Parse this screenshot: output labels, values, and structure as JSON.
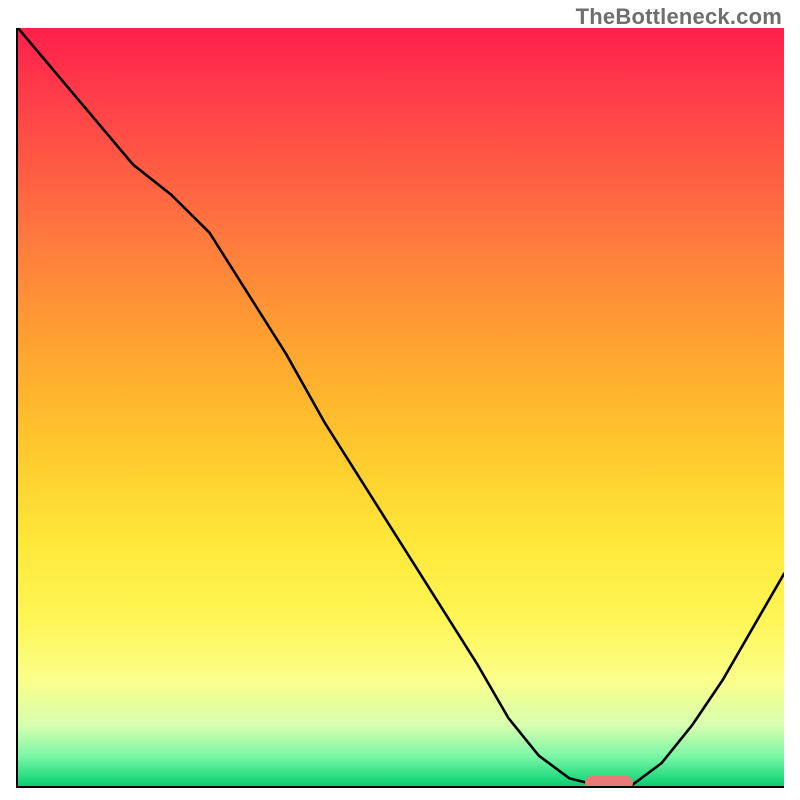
{
  "attribution": "TheBottleneck.com",
  "colors": {
    "axis": "#000000",
    "curve": "#000000",
    "marker": "#e97a78",
    "gradient_top": "#ff1f4b",
    "gradient_bottom": "#0fc96f"
  },
  "chart_data": {
    "type": "line",
    "title": "",
    "xlabel": "",
    "ylabel": "",
    "xlim": [
      0,
      100
    ],
    "ylim": [
      0,
      100
    ],
    "grid": false,
    "legend": false,
    "series": [
      {
        "name": "bottleneck-curve",
        "x": [
          0,
          5,
          10,
          15,
          20,
          25,
          30,
          35,
          40,
          45,
          50,
          55,
          60,
          64,
          68,
          72,
          76,
          80,
          84,
          88,
          92,
          96,
          100
        ],
        "values": [
          100,
          94,
          88,
          82,
          78,
          73,
          65,
          57,
          48,
          40,
          32,
          24,
          16,
          9,
          4,
          1,
          0,
          0,
          3,
          8,
          14,
          21,
          28
        ]
      }
    ],
    "annotations": [
      {
        "name": "optimal-marker",
        "x": 77,
        "y": 0,
        "shape": "pill"
      }
    ],
    "background_gradient": {
      "orientation": "vertical",
      "stops": [
        {
          "pos": 0.0,
          "color": "#ff1f4b"
        },
        {
          "pos": 0.5,
          "color": "#ffb42e"
        },
        {
          "pos": 0.8,
          "color": "#fff656"
        },
        {
          "pos": 0.96,
          "color": "#7cf7a6"
        },
        {
          "pos": 1.0,
          "color": "#0fc96f"
        }
      ]
    }
  }
}
